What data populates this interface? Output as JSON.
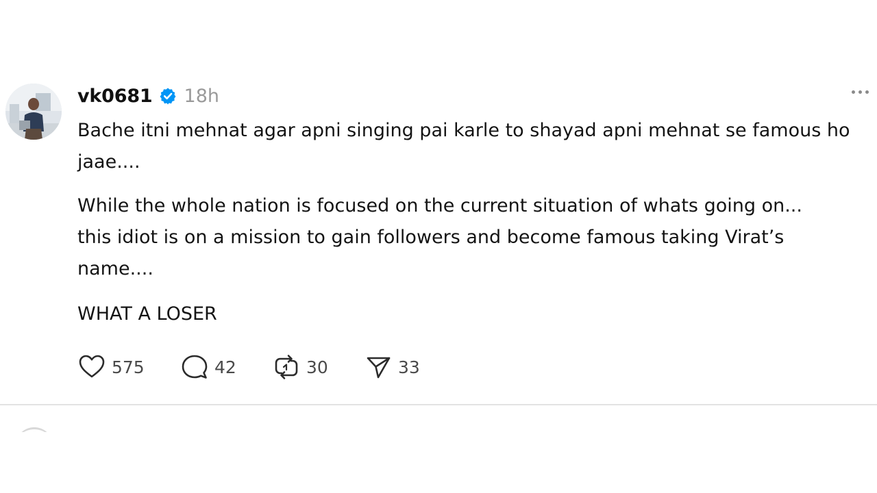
{
  "post": {
    "username": "vk0681",
    "verified_icon": "verified-badge-icon",
    "time": "18h",
    "more_icon": "more-options-icon",
    "paragraphs": [
      "Bache itni mehnat agar apni singing pai karle to shayad apni mehnat se famous ho jaae....",
      "While the whole nation is focused on the current situation of whats going on... this idiot is on a mission to gain followers and become famous taking Virat’s name....",
      "WHAT A LOSER"
    ],
    "actions": {
      "like": {
        "icon": "heart-icon",
        "count": "575"
      },
      "reply": {
        "icon": "comment-icon",
        "count": "42"
      },
      "repost": {
        "icon": "repost-icon",
        "count": "30"
      },
      "share": {
        "icon": "send-icon",
        "count": "33"
      }
    }
  },
  "colors": {
    "verified_blue": "#0095f6",
    "muted_text": "#9a9a9a",
    "divider": "#e3e3e3"
  }
}
